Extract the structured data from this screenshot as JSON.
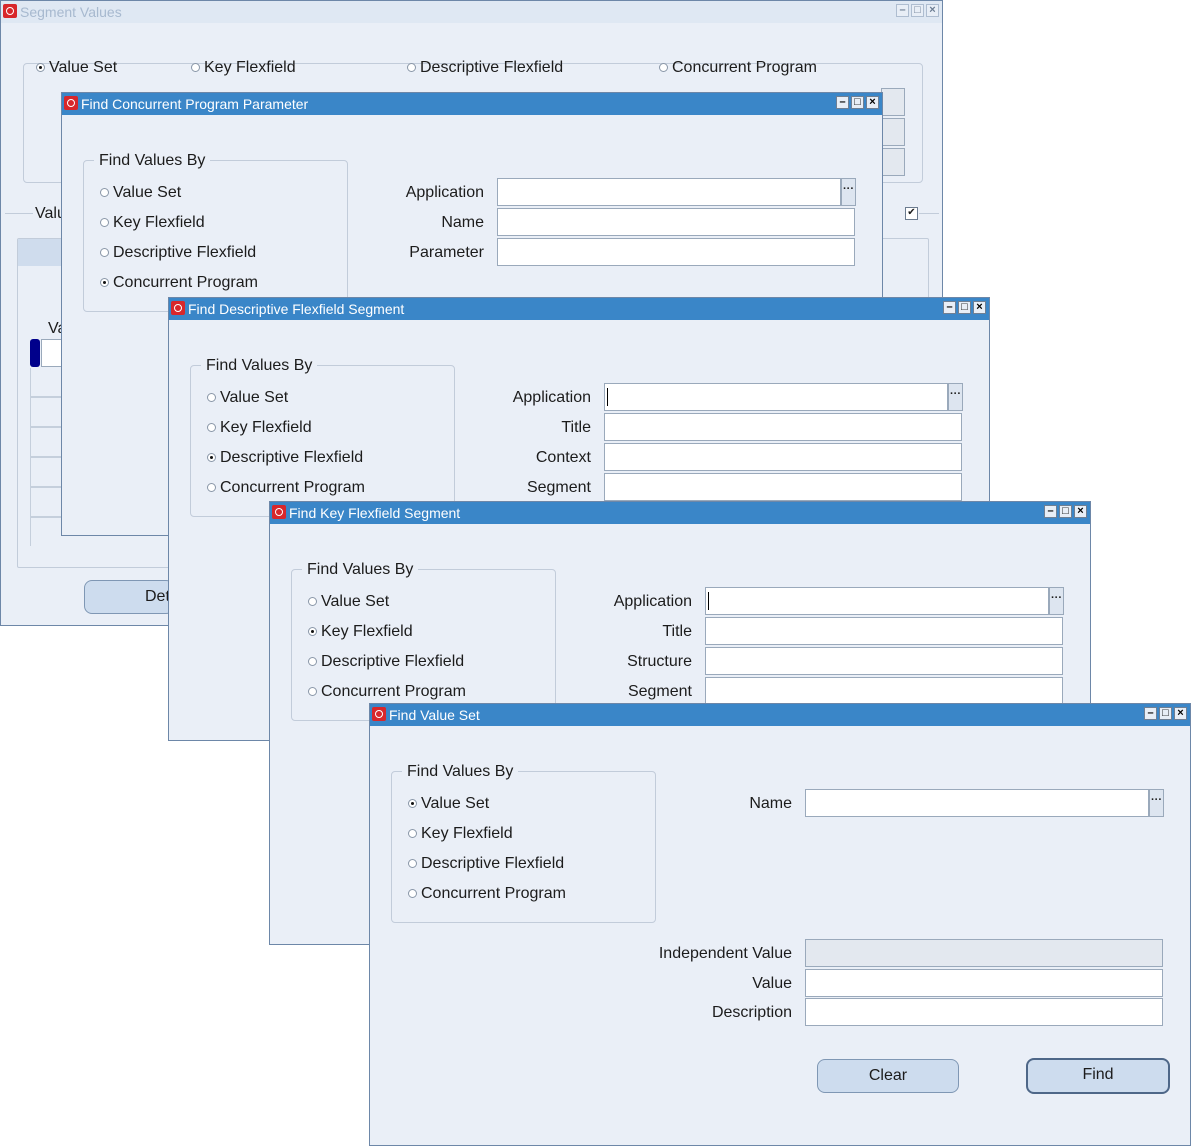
{
  "segment_values": {
    "title": "Segment Values",
    "tabs": [
      "Value Set",
      "Key Flexfield",
      "Descriptive Flexfield",
      "Concurrent Program"
    ],
    "values_label": "Valu",
    "table_col": "Va",
    "detail_button": "Det"
  },
  "concurrent_dialog": {
    "title": "Find Concurrent Program Parameter",
    "group_label": "Find Values By",
    "options": [
      "Value Set",
      "Key Flexfield",
      "Descriptive Flexfield",
      "Concurrent Program"
    ],
    "selected": "Concurrent Program",
    "fields": [
      "Application",
      "Name",
      "Parameter"
    ]
  },
  "descriptive_dialog": {
    "title": "Find Descriptive Flexfield Segment",
    "group_label": "Find Values By",
    "options": [
      "Value Set",
      "Key Flexfield",
      "Descriptive Flexfield",
      "Concurrent Program"
    ],
    "selected": "Descriptive Flexfield",
    "fields": [
      "Application",
      "Title",
      "Context",
      "Segment"
    ]
  },
  "key_dialog": {
    "title": "Find Key Flexfield Segment",
    "group_label": "Find Values By",
    "options": [
      "Value Set",
      "Key Flexfield",
      "Descriptive Flexfield",
      "Concurrent Program"
    ],
    "selected": "Key Flexfield",
    "fields": [
      "Application",
      "Title",
      "Structure",
      "Segment"
    ]
  },
  "value_set_dialog": {
    "title": "Find Value Set",
    "group_label": "Find Values By",
    "options": [
      "Value Set",
      "Key Flexfield",
      "Descriptive Flexfield",
      "Concurrent Program"
    ],
    "selected": "Value Set",
    "name_label": "Name",
    "independent_value_label": "Independent Value",
    "value_label": "Value",
    "description_label": "Description",
    "clear_button": "Clear",
    "find_button": "Find"
  },
  "icons": {
    "app_logo": "oracle-logo-icon",
    "minimize": "minimize-icon",
    "maximize": "maximize-icon",
    "close": "close-icon",
    "lov": "ellipsis-icon"
  }
}
